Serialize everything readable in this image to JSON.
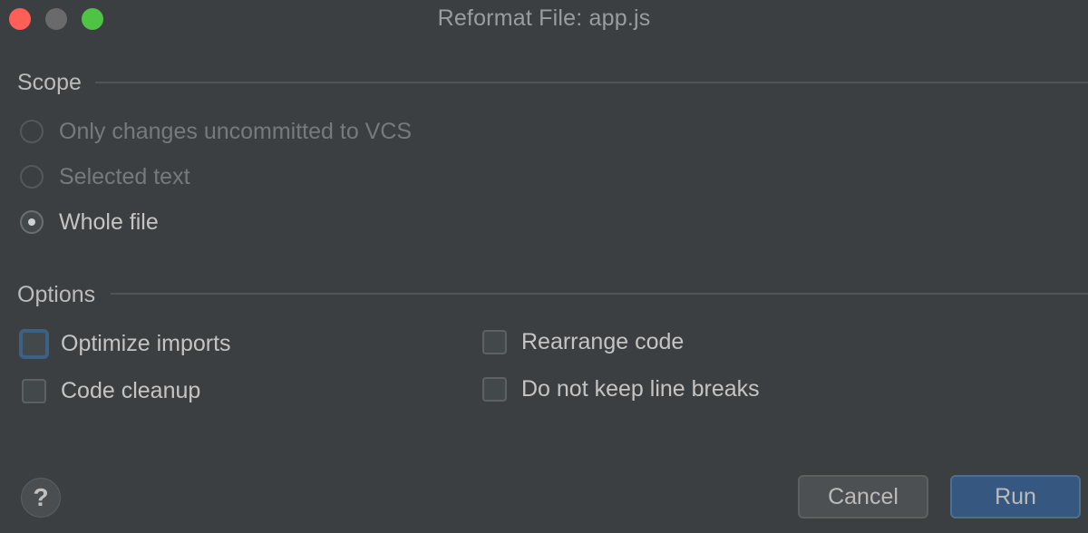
{
  "window": {
    "title": "Reformat File: app.js",
    "controls": {
      "close_color": "#ff5f57",
      "minimize_color": "#6a6a6c",
      "maximize_color": "#4fc444"
    }
  },
  "scope": {
    "label": "Scope",
    "options": [
      {
        "label": "Only changes uncommitted to VCS",
        "enabled": false,
        "selected": false
      },
      {
        "label": "Selected text",
        "enabled": false,
        "selected": false
      },
      {
        "label": "Whole file",
        "enabled": true,
        "selected": true
      }
    ]
  },
  "options": {
    "label": "Options",
    "checkboxes": [
      {
        "label": "Optimize imports",
        "checked": false,
        "focused": true
      },
      {
        "label": "Code cleanup",
        "checked": false,
        "focused": false
      },
      {
        "label": "Rearrange code",
        "checked": false,
        "focused": false
      },
      {
        "label": "Do not keep line breaks",
        "checked": false,
        "focused": false
      }
    ]
  },
  "footer": {
    "help_icon": "question-mark-icon",
    "help_glyph": "?",
    "cancel_label": "Cancel",
    "run_label": "Run",
    "accent_color": "#365880"
  }
}
